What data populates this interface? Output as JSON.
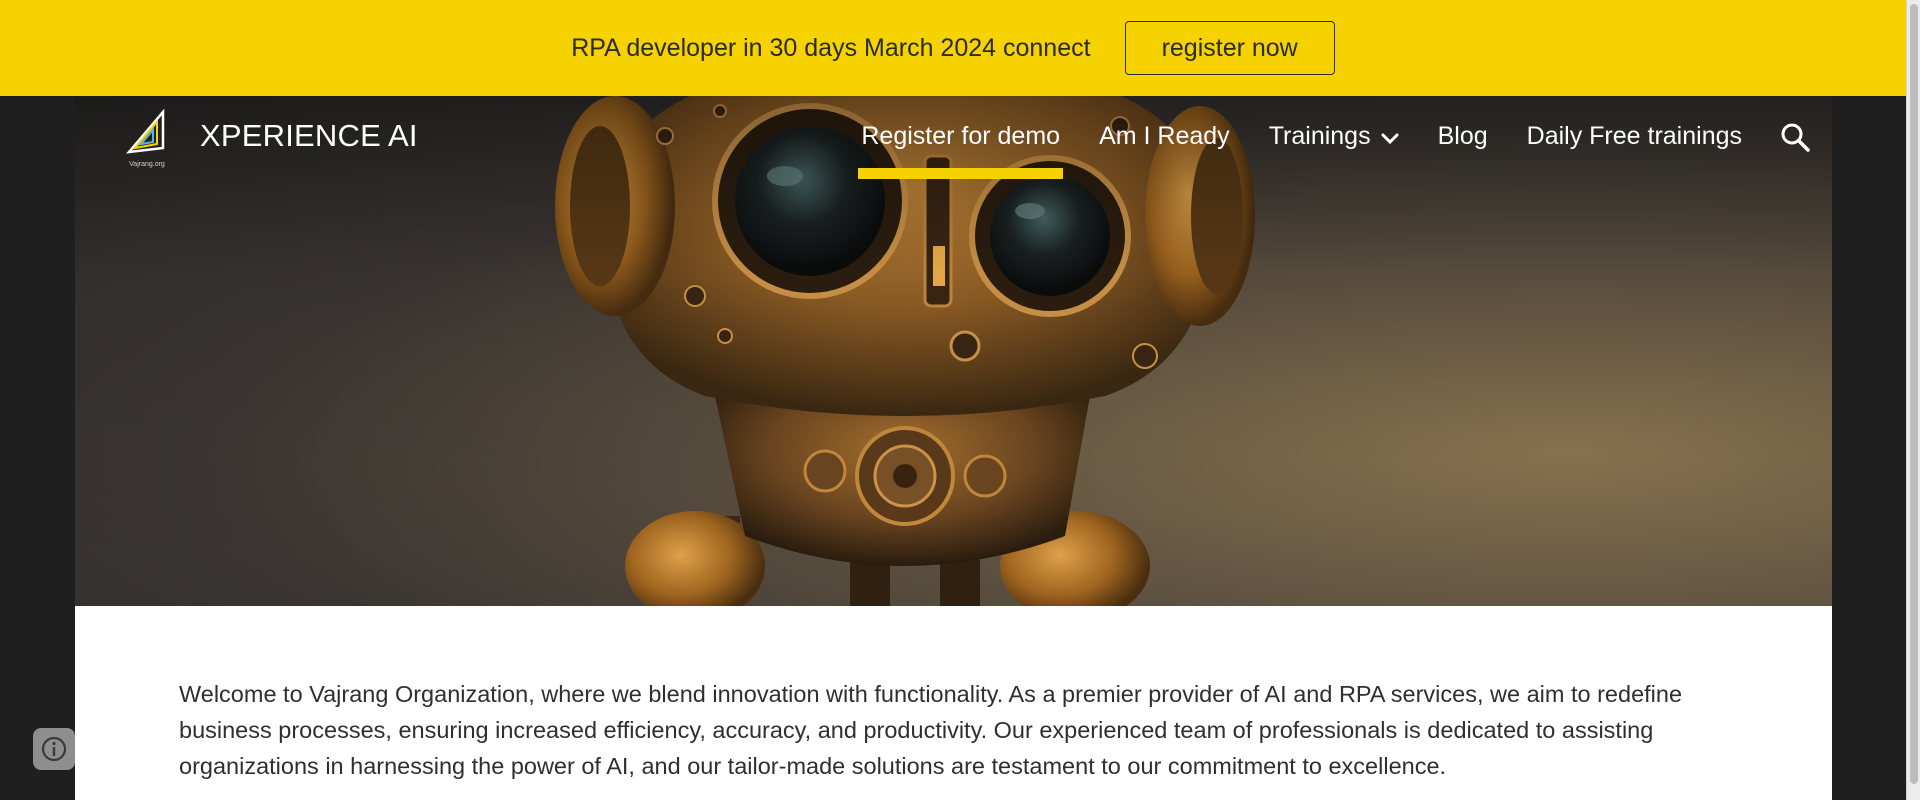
{
  "announcement": {
    "text": "RPA developer in 30 days March 2024 connect",
    "button_label": "register now"
  },
  "site": {
    "title": "XPERIENCE AI",
    "logo_caption": "Vajrang.org"
  },
  "nav": {
    "items": [
      {
        "label": "Register for demo",
        "active": true
      },
      {
        "label": "Am I Ready",
        "active": false
      },
      {
        "label": "Trainings",
        "active": false,
        "has_dropdown": true
      },
      {
        "label": "Blog",
        "active": false
      },
      {
        "label": "Daily Free trainings",
        "active": false
      }
    ],
    "search_icon": "search-icon"
  },
  "main": {
    "intro": "Welcome to Vajrang Organization, where we blend innovation with functionality. As a premier provider of AI and RPA services, we aim to redefine business processes, ensuring increased efficiency, accuracy, and productivity. Our experienced team of professionals is dedicated to assisting organizations in harnessing the power of AI, and our tailor-made solutions are testament to our commitment to excellence."
  },
  "colors": {
    "accent": "#f5d200",
    "text_dark": "#2b2b2b",
    "page_bg": "#1f1f1f"
  },
  "icons": {
    "info": "info-icon",
    "dropdown": "chevron-down-icon"
  }
}
